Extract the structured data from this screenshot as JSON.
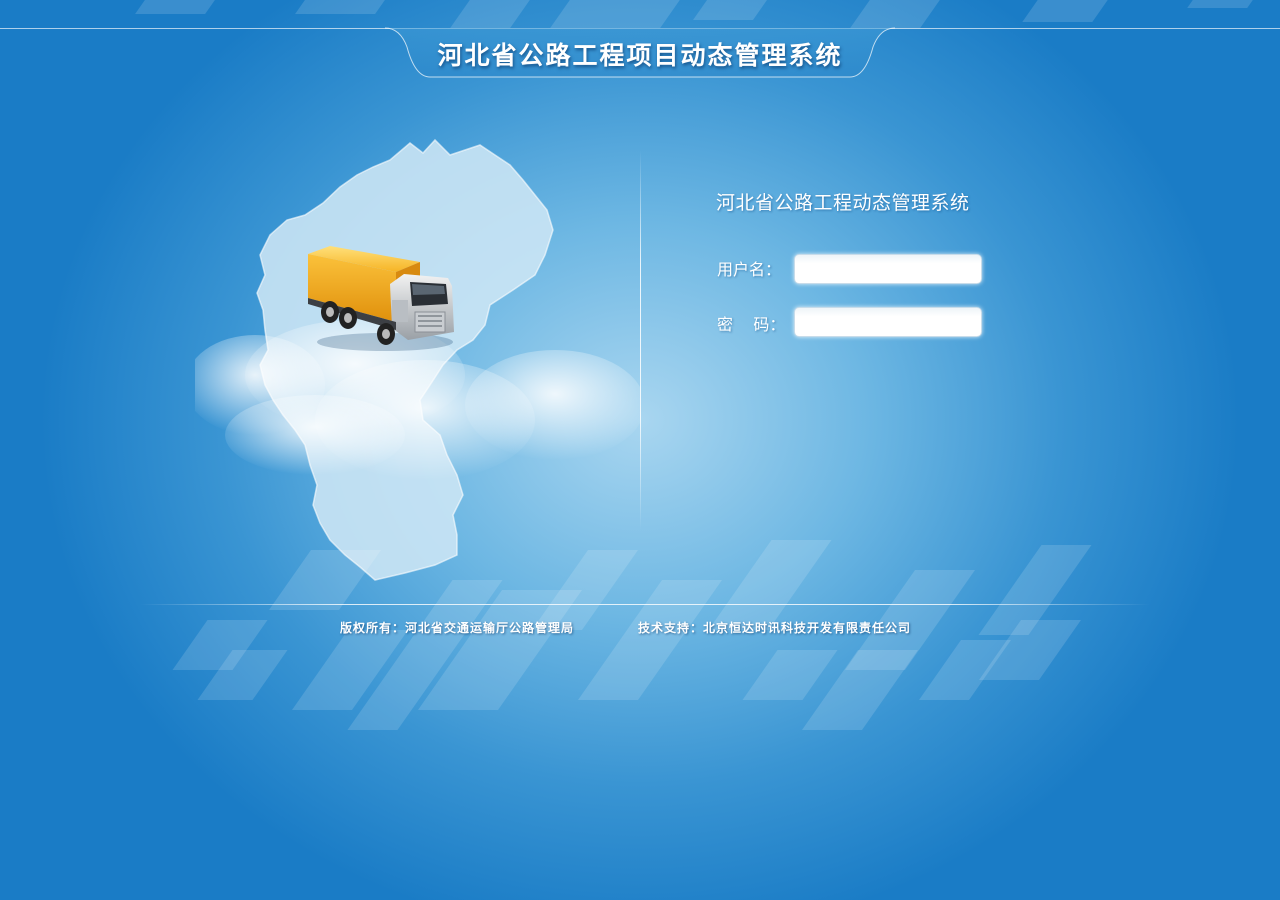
{
  "header": {
    "title": "河北省公路工程项目动态管理系统"
  },
  "login": {
    "title": "河北省公路工程动态管理系统",
    "username_label": "用户名：",
    "password_label": "密    码：",
    "username_value": "",
    "password_value": ""
  },
  "footer": {
    "copyright": "版权所有：河北省交通运输厅公路管理局",
    "support": "技术支持：北京恒达时讯科技开发有限责任公司"
  },
  "illustration": {
    "map_icon": "hebei-map-icon",
    "truck_icon": "truck-icon"
  },
  "colors": {
    "background_center": "#a9d6f0",
    "background_edge": "#1a7cc6",
    "truck_body": "#f7b32b",
    "text": "#ffffff"
  }
}
